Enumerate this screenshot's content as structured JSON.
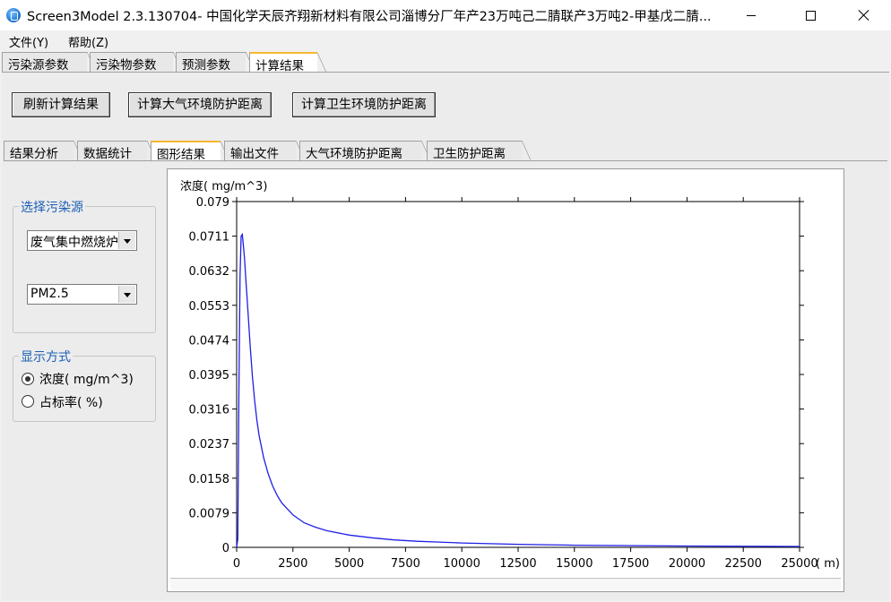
{
  "window": {
    "title": "Screen3Model 2.3.130704- 中国化学天辰齐翔新材料有限公司淄博分厂年产23万吨己二腈联产3万吨2-甲基戊二腈..."
  },
  "menu": {
    "file": "文件(Y)",
    "help": "帮助(Z)"
  },
  "outer_tabs": [
    "污染源参数",
    "污染物参数",
    "预测参数",
    "计算结果"
  ],
  "outer_active": 3,
  "buttons": {
    "refresh": "刷新计算结果",
    "atmos": "计算大气环境防护距离",
    "health": "计算卫生环境防护距离"
  },
  "inner_tabs": [
    "结果分析",
    "数据统计",
    "图形结果",
    "输出文件",
    "大气环境防护距离",
    "卫生防护距离"
  ],
  "inner_active": 2,
  "source_group": {
    "caption": "选择污染源",
    "source_value": "废气集中燃烧炉",
    "pollutant_value": "PM2.5"
  },
  "display_group": {
    "caption": "显示方式",
    "option_conc": "浓度( mg/m^3)",
    "option_pct": "占标率( %)",
    "selected": "conc"
  },
  "colors": {
    "line": "#1f1fe6",
    "active_tab_accent": "#f7b733",
    "group_caption": "#1a5fb4"
  },
  "chart_data": {
    "type": "line",
    "ylabel": "浓度( mg/m^3)",
    "xunit": "( m)",
    "ylim": [
      0,
      0.079
    ],
    "xlim": [
      0,
      25000
    ],
    "yticks": [
      "0",
      "0.0079",
      "0.0158",
      "0.0237",
      "0.0316",
      "0.0395",
      "0.0474",
      "0.0553",
      "0.0632",
      "0.0711",
      "0.079"
    ],
    "xticks": [
      "0",
      "2500",
      "5000",
      "7500",
      "10000",
      "12500",
      "15000",
      "17500",
      "20000",
      "22500",
      "25000"
    ],
    "series": [
      {
        "x": [
          0,
          50,
          100,
          150,
          200,
          250,
          300,
          350,
          400,
          500,
          600,
          700,
          800,
          900,
          1000,
          1200,
          1400,
          1600,
          1800,
          2000,
          2500,
          3000,
          3500,
          4000,
          5000,
          6000,
          7000,
          8000,
          9000,
          10000,
          12500,
          15000,
          20000,
          25000
        ],
        "y": [
          0,
          0.002,
          0.035,
          0.062,
          0.0711,
          0.0715,
          0.069,
          0.066,
          0.062,
          0.054,
          0.046,
          0.039,
          0.0335,
          0.029,
          0.0255,
          0.0205,
          0.0168,
          0.014,
          0.0119,
          0.0102,
          0.0074,
          0.0056,
          0.0046,
          0.0038,
          0.0028,
          0.0022,
          0.0017,
          0.0014,
          0.0012,
          0.001,
          0.0007,
          0.0005,
          0.0003,
          0.0002
        ]
      }
    ]
  }
}
